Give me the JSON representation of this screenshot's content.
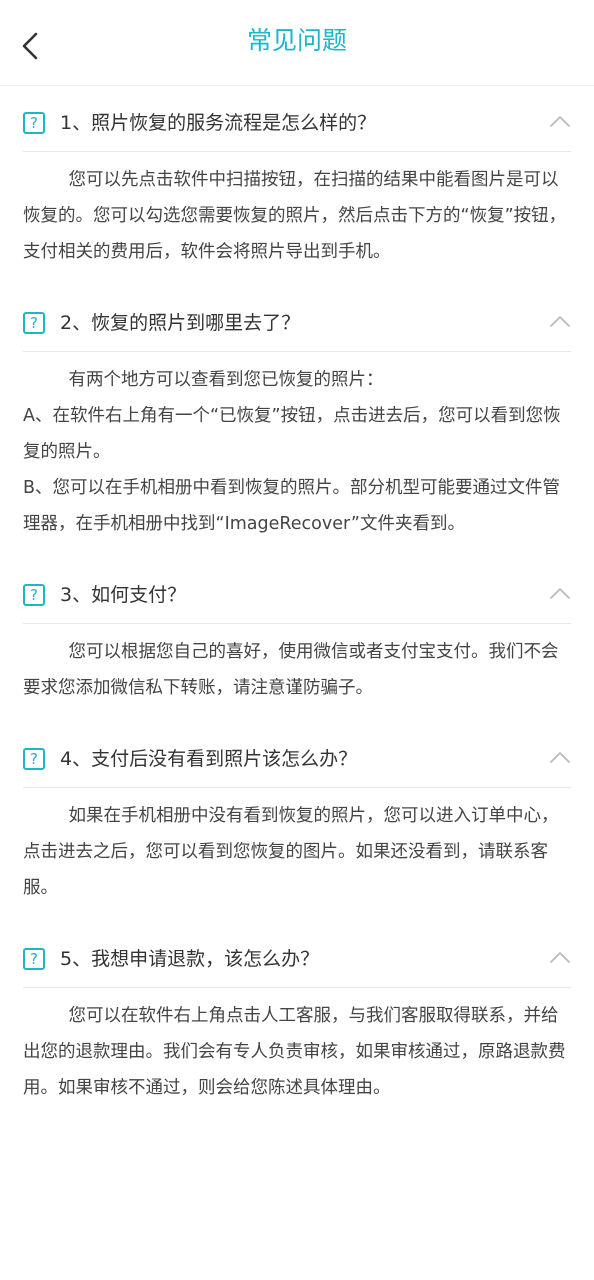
{
  "header": {
    "title": "常见问题",
    "back_icon": "chevron-left-icon"
  },
  "colors": {
    "accent": "#1bb7c8",
    "text": "#333333",
    "divider": "#e8e8e8"
  },
  "faq": [
    {
      "badge": "?",
      "question": "1、照片恢复的服务流程是怎么样的？",
      "answer": [
        "您可以先点击软件中扫描按钮，在扫描的结果中能看图片是可以恢复的。您可以勾选您需要恢复的照片，然后点击下方的“恢复”按钮，支付相关的费用后，软件会将照片导出到手机。"
      ]
    },
    {
      "badge": "?",
      "question": "2、恢复的照片到哪里去了？",
      "answer": [
        "有两个地方可以查看到您已恢复的照片：",
        "A、在软件右上角有一个“已恢复”按钮，点击进去后，您可以看到您恢复的照片。",
        "B、您可以在手机相册中看到恢复的照片。部分机型可能要通过文件管理器，在手机相册中找到“ImageRecover”文件夹看到。"
      ]
    },
    {
      "badge": "?",
      "question": "3、如何支付？",
      "answer": [
        "您可以根据您自己的喜好，使用微信或者支付宝支付。我们不会要求您添加微信私下转账，请注意谨防骗子。"
      ]
    },
    {
      "badge": "?",
      "question": "4、支付后没有看到照片该怎么办？",
      "answer": [
        "如果在手机相册中没有看到恢复的照片，您可以进入订单中心，点击进去之后，您可以看到您恢复的图片。如果还没看到，请联系客服。"
      ]
    },
    {
      "badge": "?",
      "question": "5、我想申请退款，该怎么办？",
      "answer": [
        "您可以在软件右上角点击人工客服，与我们客服取得联系，并给出您的退款理由。我们会有专人负责审核，如果审核通过，原路退款费用。如果审核不通过，则会给您陈述具体理由。"
      ]
    }
  ]
}
